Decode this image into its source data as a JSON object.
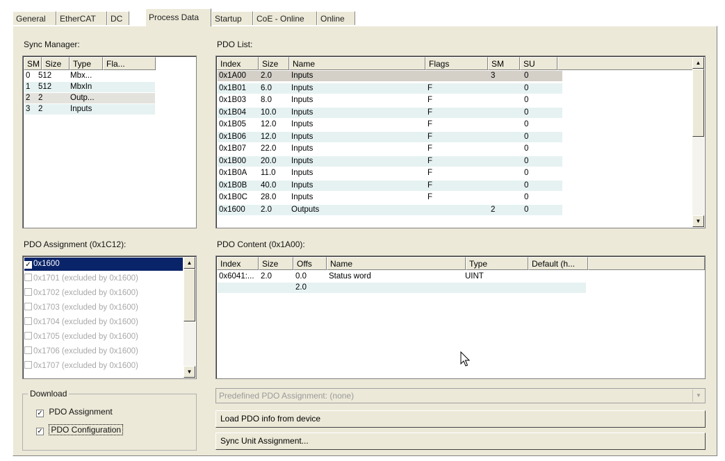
{
  "tabs": [
    "General",
    "EtherCAT",
    "DC",
    "Process Data",
    "Startup",
    "CoE - Online",
    "Online"
  ],
  "sync_manager": {
    "label": "Sync Manager:",
    "columns": [
      "SM",
      "Size",
      "Type",
      "Fla..."
    ],
    "rows": [
      [
        "0",
        "512",
        "Mbx...",
        ""
      ],
      [
        "1",
        "512",
        "MbxIn",
        ""
      ],
      [
        "2",
        "2",
        "Outp...",
        ""
      ],
      [
        "3",
        "2",
        "Inputs",
        ""
      ]
    ]
  },
  "pdo_list": {
    "label": "PDO List:",
    "columns": [
      "Index",
      "Size",
      "Name",
      "Flags",
      "SM",
      "SU"
    ],
    "rows": [
      [
        "0x1A00",
        "2.0",
        "Inputs",
        "",
        "3",
        "0"
      ],
      [
        "0x1B01",
        "6.0",
        "Inputs",
        "F",
        "",
        "0"
      ],
      [
        "0x1B03",
        "8.0",
        "Inputs",
        "F",
        "",
        "0"
      ],
      [
        "0x1B04",
        "10.0",
        "Inputs",
        "F",
        "",
        "0"
      ],
      [
        "0x1B05",
        "12.0",
        "Inputs",
        "F",
        "",
        "0"
      ],
      [
        "0x1B06",
        "12.0",
        "Inputs",
        "F",
        "",
        "0"
      ],
      [
        "0x1B07",
        "22.0",
        "Inputs",
        "F",
        "",
        "0"
      ],
      [
        "0x1B00",
        "20.0",
        "Inputs",
        "F",
        "",
        "0"
      ],
      [
        "0x1B0A",
        "11.0",
        "Inputs",
        "F",
        "",
        "0"
      ],
      [
        "0x1B0B",
        "40.0",
        "Inputs",
        "F",
        "",
        "0"
      ],
      [
        "0x1B0C",
        "28.0",
        "Inputs",
        "F",
        "",
        "0"
      ],
      [
        "0x1600",
        "2.0",
        "Outputs",
        "",
        "2",
        "0"
      ]
    ]
  },
  "pdo_assignment": {
    "label": "PDO Assignment (0x1C12):",
    "items": [
      {
        "text": "0x1600",
        "checked": true,
        "selected": true
      },
      {
        "text": "0x1701 (excluded by 0x1600)",
        "checked": false,
        "selected": false
      },
      {
        "text": "0x1702 (excluded by 0x1600)",
        "checked": false,
        "selected": false
      },
      {
        "text": "0x1703 (excluded by 0x1600)",
        "checked": false,
        "selected": false
      },
      {
        "text": "0x1704 (excluded by 0x1600)",
        "checked": false,
        "selected": false
      },
      {
        "text": "0x1705 (excluded by 0x1600)",
        "checked": false,
        "selected": false
      },
      {
        "text": "0x1706 (excluded by 0x1600)",
        "checked": false,
        "selected": false
      },
      {
        "text": "0x1707 (excluded by 0x1600)",
        "checked": false,
        "selected": false
      }
    ]
  },
  "pdo_content": {
    "label": "PDO Content (0x1A00):",
    "columns": [
      "Index",
      "Size",
      "Offs",
      "Name",
      "Type",
      "Default (h..."
    ],
    "rows": [
      [
        "0x6041:...",
        "2.0",
        "0.0",
        "Status word",
        "UINT",
        ""
      ],
      [
        "",
        "",
        "2.0",
        "",
        "",
        ""
      ]
    ]
  },
  "download": {
    "label": "Download",
    "pdo_assignment": "PDO Assignment",
    "pdo_configuration": "PDO Configuration"
  },
  "predefined_combo": "Predefined PDO Assignment: (none)",
  "load_button": "Load PDO info from device",
  "sync_unit_button": "Sync Unit Assignment...",
  "colors": {
    "selection": "#0a246a",
    "panel": "#ece9d8",
    "row_alt": "#e6f2f2"
  }
}
